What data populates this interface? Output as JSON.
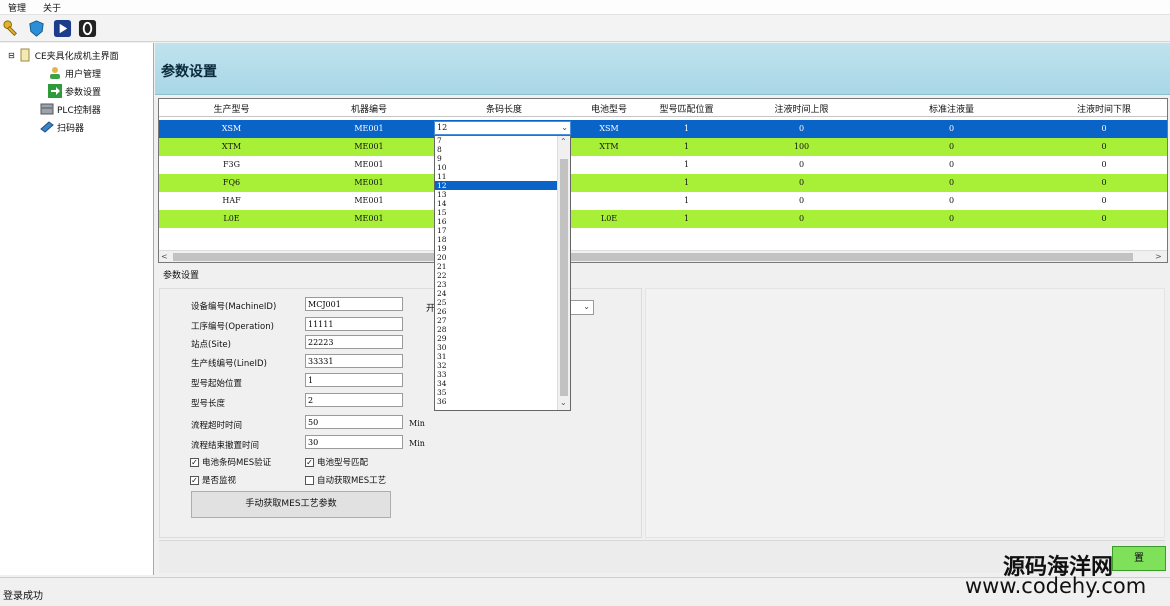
{
  "menu": {
    "items": [
      "管理",
      "关于"
    ]
  },
  "toolbar": {
    "buttons": [
      "key-icon",
      "shield-icon",
      "play-icon",
      "stop-icon"
    ]
  },
  "tree": {
    "root": "CE夹具化成机主界面",
    "items": [
      "用户管理",
      "参数设置",
      "PLC控制器",
      "扫码器"
    ]
  },
  "banner": {
    "title": "参数设置"
  },
  "grid": {
    "columns": [
      "生产型号",
      "机器编号",
      "条码长度",
      "电池型号",
      "型号匹配位置",
      "注液时间上限",
      "标准注液量",
      "注液时间下限"
    ],
    "rows": [
      [
        "XSM",
        "ME001",
        "",
        "XSM",
        "1",
        "0",
        "0",
        "0"
      ],
      [
        "XTM",
        "ME001",
        "",
        "XTM",
        "1",
        "100",
        "0",
        "0"
      ],
      [
        "F3G",
        "ME001",
        "",
        "",
        "1",
        "0",
        "0",
        "0"
      ],
      [
        "FQ6",
        "ME001",
        "",
        "",
        "1",
        "0",
        "0",
        "0"
      ],
      [
        "HAF",
        "ME001",
        "",
        "",
        "1",
        "0",
        "0",
        "0"
      ],
      [
        "L0E",
        "ME001",
        "",
        "L0E",
        "1",
        "0",
        "0",
        "0"
      ]
    ],
    "scroll_left": "<",
    "scroll_right": ">"
  },
  "dropdown": {
    "selected": "12",
    "arrow": "⌄",
    "options": [
      "7",
      "8",
      "9",
      "10",
      "11",
      "12",
      "13",
      "14",
      "15",
      "16",
      "17",
      "18",
      "19",
      "20",
      "21",
      "22",
      "23",
      "24",
      "25",
      "26",
      "27",
      "28",
      "29",
      "30",
      "31",
      "32",
      "33",
      "34",
      "35",
      "36"
    ],
    "scroll_up": "⌃",
    "scroll_down": "⌄"
  },
  "params": {
    "group_label": "参数设置",
    "machine_id_label": "设备编号(MachineID)",
    "machine_id_value": "MCJ001",
    "operation_label": "工序编号(Operation)",
    "operation_value": "11111",
    "site_label": "站点(Site)",
    "site_value": "22223",
    "line_label": "生产线编号(LineID)",
    "line_value": "33331",
    "model_start_label": "型号起始位置",
    "model_start_value": "1",
    "model_len_label": "型号长度",
    "model_len_value": "2",
    "timeout_label": "流程超时时间",
    "timeout_value": "50",
    "reset_label": "流程结束撤置时间",
    "reset_value": "30",
    "unit": "Min",
    "cb1": "电池条码MES验证",
    "cb2": "电池型号匹配",
    "cb3": "是否监视",
    "cb4": "自动获取MES工艺",
    "manual_button": "手动获取MES工艺参数",
    "truncated_label": "开",
    "combo_arrow": "⌄"
  },
  "save_button": "置",
  "status": {
    "text": "登录成功"
  },
  "watermark": {
    "line1": "源码海洋网",
    "line2": "www.codehy.com"
  }
}
